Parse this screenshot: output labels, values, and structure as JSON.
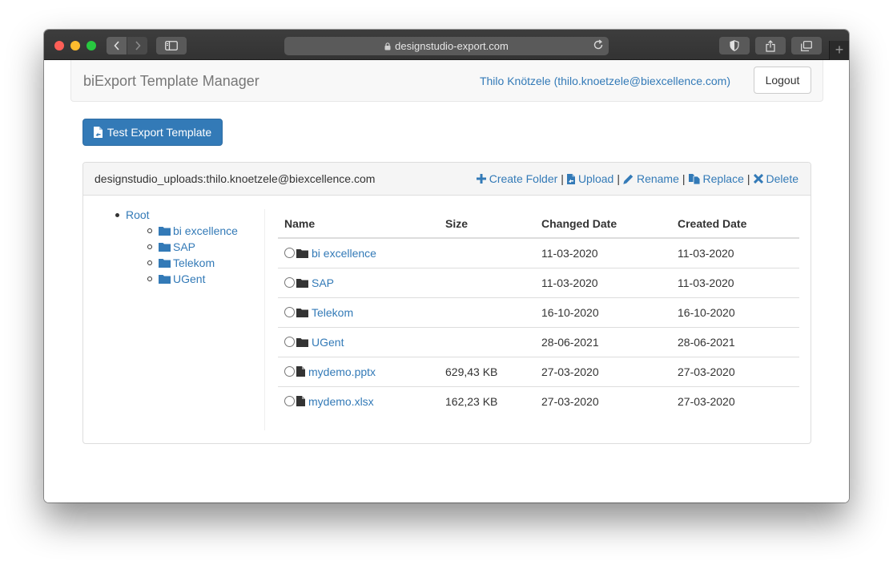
{
  "browser": {
    "url": "designstudio-export.com",
    "new_tab": "+"
  },
  "navbar": {
    "brand": "biExport Template Manager",
    "user": "Thilo Knötzele (thilo.knoetzele@biexcellence.com)",
    "logout_label": "Logout"
  },
  "toolbar": {
    "test_export_label": "Test Export Template"
  },
  "panel": {
    "path": "designstudio_uploads:thilo.knoetzele@biexcellence.com",
    "actions": {
      "create_folder": "Create Folder",
      "upload": "Upload",
      "rename": "Rename",
      "replace": "Replace",
      "delete": "Delete",
      "separator": "|"
    }
  },
  "tree": {
    "root": "Root",
    "children": [
      "bi excellence",
      "SAP",
      "Telekom",
      "UGent"
    ]
  },
  "table": {
    "headers": {
      "name": "Name",
      "size": "Size",
      "changed": "Changed Date",
      "created": "Created Date"
    },
    "rows": [
      {
        "icon": "folder-icon",
        "name": "bi excellence",
        "size": "",
        "changed": "11-03-2020",
        "created": "11-03-2020"
      },
      {
        "icon": "folder-icon",
        "name": "SAP",
        "size": "",
        "changed": "11-03-2020",
        "created": "11-03-2020"
      },
      {
        "icon": "folder-icon",
        "name": "Telekom",
        "size": "",
        "changed": "16-10-2020",
        "created": "16-10-2020"
      },
      {
        "icon": "folder-icon",
        "name": "UGent",
        "size": "",
        "changed": "28-06-2021",
        "created": "28-06-2021"
      },
      {
        "icon": "file-icon",
        "name": "mydemo.pptx",
        "size": "629,43 KB",
        "changed": "27-03-2020",
        "created": "27-03-2020"
      },
      {
        "icon": "file-icon",
        "name": "mydemo.xlsx",
        "size": "162,23 KB",
        "changed": "27-03-2020",
        "created": "27-03-2020"
      }
    ]
  },
  "colors": {
    "link": "#337ab7",
    "primary_button": "#337ab7",
    "titlebar": "#383838"
  }
}
